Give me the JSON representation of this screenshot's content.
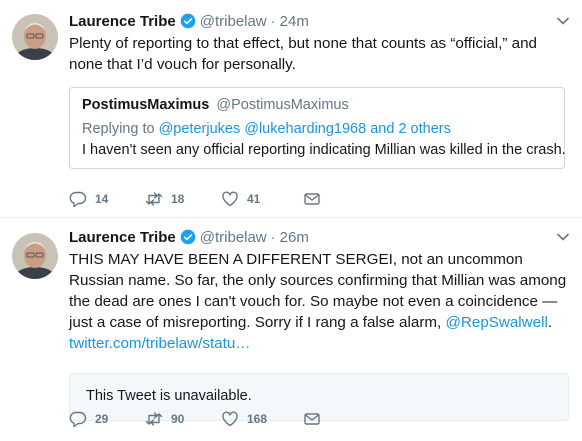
{
  "tweets": [
    {
      "author_name": "Laurence Tribe",
      "author_handle": "@tribelaw",
      "separator": "·",
      "time": "24m",
      "text": "Plenty of reporting to that effect, but none that counts as “official,” and none that I’d vouch for personally.",
      "quote": {
        "author_name": "PostimusMaximus",
        "author_handle": "@PostimusMaximus",
        "reply_prefix": "Replying to",
        "reply_mentions": "@peterjukes @lukeharding1968",
        "reply_suffix": "and 2 others",
        "text": "I haven't seen any official reporting indicating Millian was killed in the crash."
      },
      "actions": {
        "replies": "14",
        "retweets": "18",
        "likes": "41"
      }
    },
    {
      "author_name": "Laurence Tribe",
      "author_handle": "@tribelaw",
      "separator": "·",
      "time": "26m",
      "text": "THIS MAY HAVE BEEN A DIFFERENT SERGEI, not an uncommon Russian name. So far, the only sources confirming that Millian was among the dead are ones I can't vouch for. So maybe not even a coincidence — just a case of misreporting. Sorry if I rang a false alarm,",
      "mention": "@RepSwalwell",
      "text_end": ".",
      "url": "twitter.com/tribelaw/statu…",
      "unavailable_text": "This Tweet is unavailable.",
      "actions": {
        "replies": "29",
        "retweets": "90",
        "likes": "168"
      }
    }
  ],
  "colors": {
    "link": "#1b95e0",
    "muted": "#657786",
    "verified": "#1da1f2"
  },
  "icons": [
    "verified-badge-icon",
    "caret-down-icon",
    "reply-icon",
    "retweet-icon",
    "like-icon",
    "direct-message-icon"
  ]
}
